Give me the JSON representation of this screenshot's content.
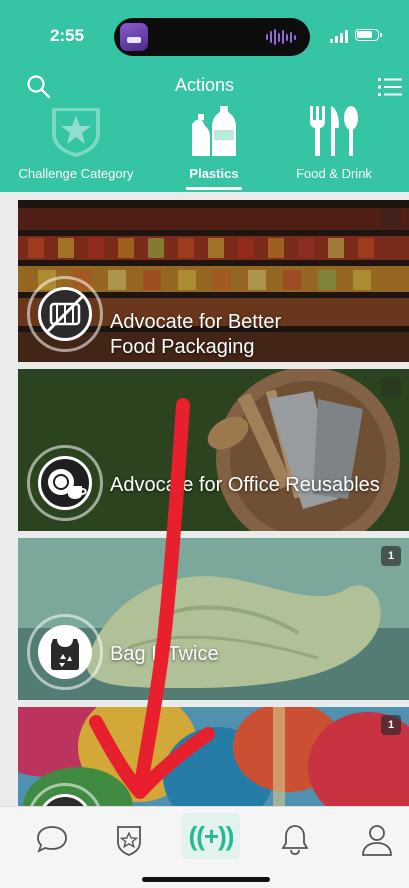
{
  "status_bar": {
    "time": "2:55"
  },
  "header": {
    "title": "Actions",
    "background_color": "#35c4a4",
    "categories": [
      {
        "label": "Challenge Category",
        "icon": "star-shield-icon",
        "active": false
      },
      {
        "label": "Plastics",
        "icon": "plastic-bottle-icon",
        "active": true
      },
      {
        "label": "Food & Drink",
        "icon": "cutlery-icon",
        "active": false
      }
    ]
  },
  "actions": [
    {
      "title_line1": "Advocate for Better",
      "title_line2": "Food Packaging",
      "icon": "no-packaging-icon"
    },
    {
      "title_line1": "Advocate for Office Reusables",
      "title_line2": "",
      "icon": "dish-cup-icon"
    },
    {
      "title_line1": "Bag It Twice",
      "title_line2": "",
      "icon": "recycle-bag-icon",
      "badge": "1"
    },
    {
      "title_line1": "",
      "title_line2": "",
      "icon": "balloon-icon",
      "badge": "1"
    }
  ],
  "tabbar": {
    "items": [
      "chat-icon",
      "star-badge-icon",
      "add-action-icon",
      "bell-icon",
      "profile-icon"
    ],
    "add_label": "((+))",
    "active_color": "#27b895"
  },
  "annotation": {
    "arrow_color": "#e8202e"
  }
}
